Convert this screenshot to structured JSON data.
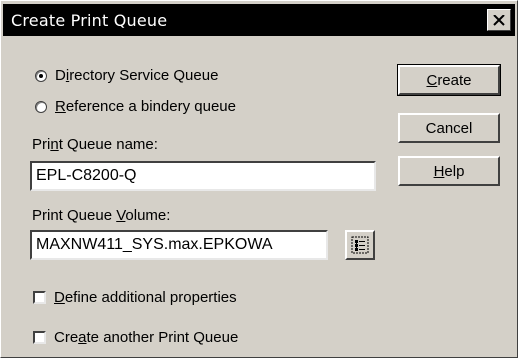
{
  "window": {
    "title": "Create Print Queue",
    "close_icon": "close-icon"
  },
  "radios": [
    {
      "label": "Directory Service Queue",
      "accel": "i",
      "checked": true
    },
    {
      "label": "Reference a bindery queue",
      "accel": "R",
      "checked": false
    }
  ],
  "queue_name": {
    "label": "Print Queue name:",
    "accel": "n",
    "value": "EPL-C8200-Q"
  },
  "queue_volume": {
    "label": "Print Queue Volume:",
    "accel": "V",
    "value": "MAXNW411_SYS.max.EPKOWA",
    "browse_icon": "tree-browse-icon"
  },
  "checkboxes": [
    {
      "label": "Define additional properties",
      "accel": "D",
      "checked": false
    },
    {
      "label": "Create another Print Queue",
      "accel": "a",
      "checked": false
    }
  ],
  "buttons": {
    "create": {
      "label": "Create",
      "accel": "C"
    },
    "cancel": {
      "label": "Cancel"
    },
    "help": {
      "label": "Help",
      "accel": "H"
    }
  }
}
